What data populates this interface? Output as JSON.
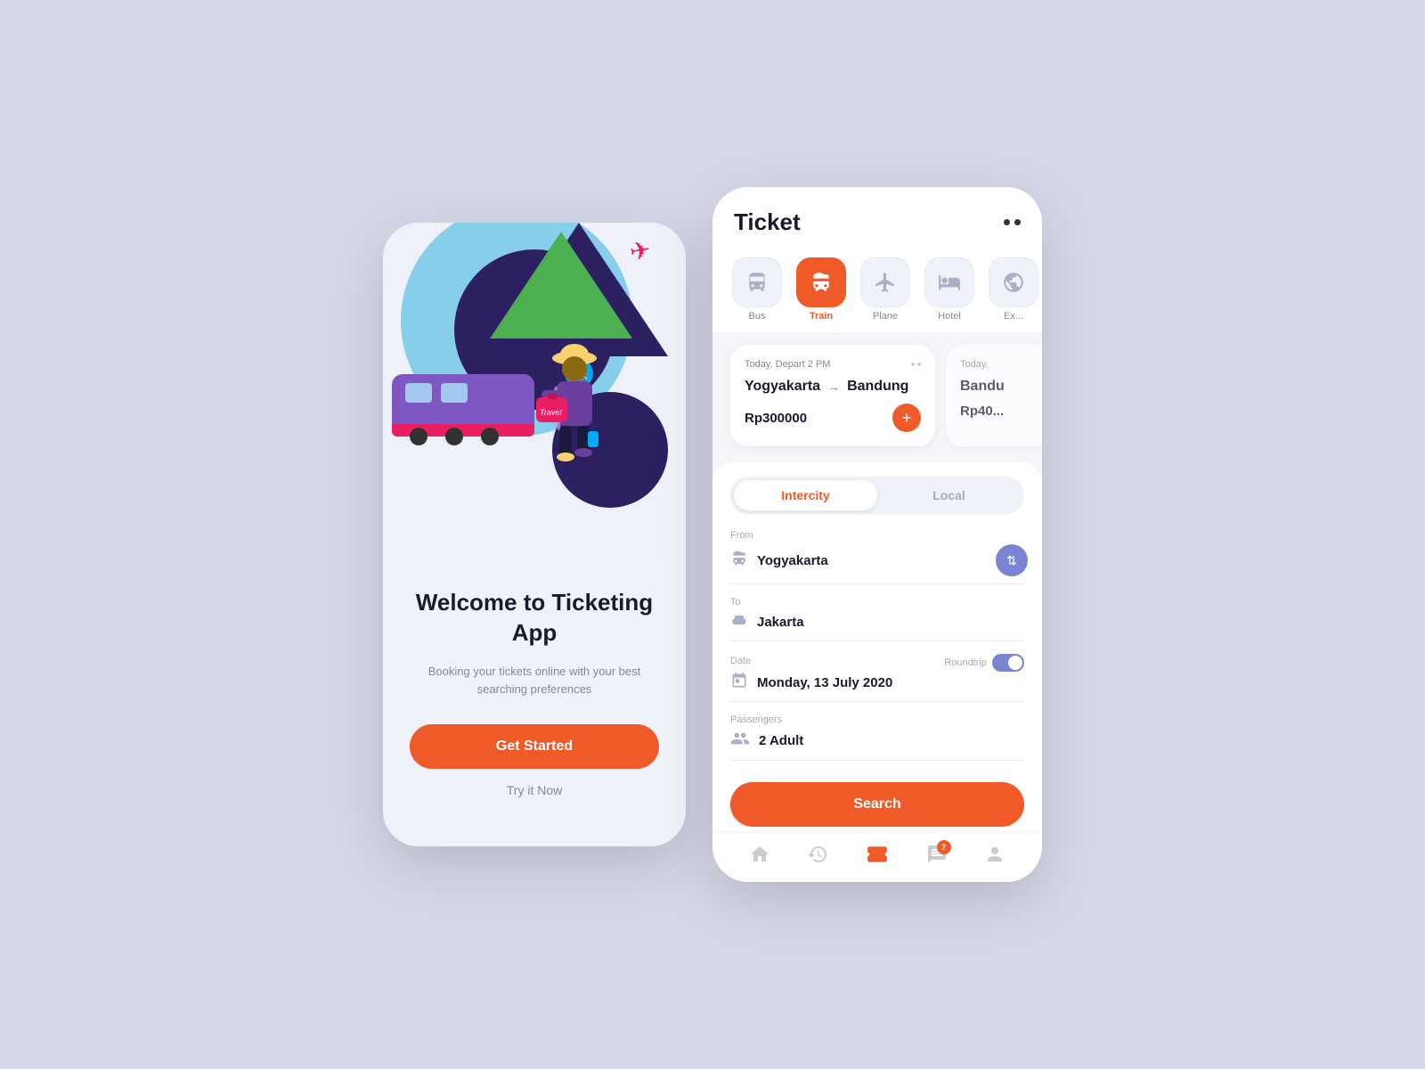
{
  "phone1": {
    "title": "Welcome to\nTicketing App",
    "subtitle": "Booking your tickets online with your best searching preferences",
    "get_started": "Get Started",
    "try_now": "Try it Now"
  },
  "phone2": {
    "header": {
      "title": "Ticket"
    },
    "categories": [
      {
        "id": "bus",
        "label": "Bus",
        "active": false
      },
      {
        "id": "train",
        "label": "Train",
        "active": true
      },
      {
        "id": "plane",
        "label": "Plane",
        "active": false
      },
      {
        "id": "hotel",
        "label": "Hotel",
        "active": false
      },
      {
        "id": "explore",
        "label": "Ex...",
        "active": false
      }
    ],
    "ticket_cards": [
      {
        "date": "Today, Depart 2 PM",
        "from": "Yogyakarta",
        "to": "Bandung",
        "price": "Rp300000"
      },
      {
        "date": "Today,",
        "from": "Bandu",
        "to": "...",
        "price": "Rp40..."
      }
    ],
    "tabs": [
      "Intercity",
      "Local"
    ],
    "active_tab": "Intercity",
    "form": {
      "from_label": "From",
      "from_value": "Yogyakarta",
      "to_label": "To",
      "to_value": "Jakarta",
      "date_label": "Date",
      "date_value": "Monday, 13 July 2020",
      "roundtrip_label": "Roundtrip",
      "passengers_label": "Passengers",
      "passengers_value": "2 Adult"
    },
    "search_btn": "Search",
    "nav": [
      {
        "id": "home",
        "label": "Home"
      },
      {
        "id": "history",
        "label": "History"
      },
      {
        "id": "tickets",
        "label": "Tickets",
        "active": true
      },
      {
        "id": "chat",
        "label": "Chat",
        "badge": "2"
      },
      {
        "id": "profile",
        "label": "Profile"
      }
    ]
  }
}
